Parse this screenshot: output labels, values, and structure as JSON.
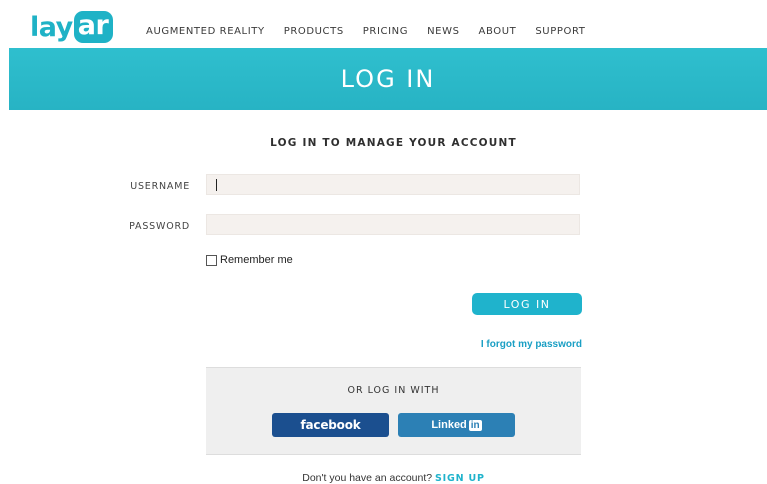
{
  "header": {
    "logo": {
      "part1": "lay",
      "part2": "ar"
    },
    "nav": [
      "AUGMENTED REALITY",
      "PRODUCTS",
      "PRICING",
      "NEWS",
      "ABOUT",
      "SUPPORT"
    ]
  },
  "banner": {
    "title": "LOG IN"
  },
  "form": {
    "subtitle": "LOG IN TO MANAGE YOUR ACCOUNT",
    "username_label": "USERNAME",
    "username_value": "",
    "password_label": "PASSWORD",
    "password_value": "",
    "remember_label": "Remember me",
    "remember_checked": false,
    "login_button": "LOG IN",
    "forgot_link": "I forgot my password"
  },
  "social": {
    "title": "OR LOG IN WITH",
    "facebook_label": "facebook",
    "linkedin_label": "Linked",
    "linkedin_box": "in"
  },
  "signup": {
    "prompt": "Don't you have an account?",
    "link": "SIGN UP"
  },
  "colors": {
    "accent": "#1fb2c6",
    "facebook": "#1b4f8f",
    "linkedin": "#2c80b5"
  }
}
